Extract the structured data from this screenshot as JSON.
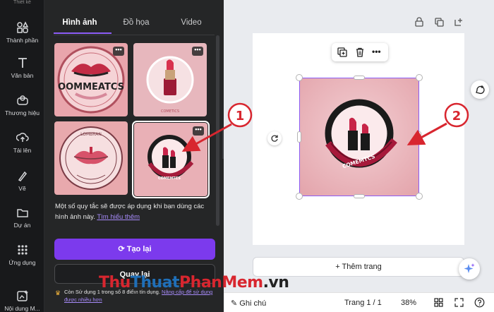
{
  "rail": {
    "top_label": "Thiết kế",
    "items": [
      {
        "label": "Thành phần",
        "icon": "elements-icon"
      },
      {
        "label": "Văn bản",
        "icon": "text-icon"
      },
      {
        "label": "Thương hiệu",
        "icon": "brand-icon"
      },
      {
        "label": "Tải lên",
        "icon": "upload-icon"
      },
      {
        "label": "Vẽ",
        "icon": "draw-icon"
      },
      {
        "label": "Dự án",
        "icon": "folder-icon"
      },
      {
        "label": "Ứng dụng",
        "icon": "apps-icon"
      },
      {
        "label": "Nội dung M...",
        "icon": "magic-media-icon"
      }
    ]
  },
  "panel": {
    "tabs": [
      "Hình ảnh",
      "Đồ họa",
      "Video"
    ],
    "active_tab": 0,
    "thumb_texts": [
      "OOMMEATCS",
      "COMETICS",
      "LOMBRAN",
      "COMEMTCS"
    ],
    "info_text": "Một số quy tắc sẽ được áp dụng khi bạn dùng các hình ảnh này.",
    "info_link": "Tìm hiểu thêm",
    "regen_label": "Tạo lại",
    "back_label": "Quay lại",
    "credit_text": "Còn Sử dụng 1 trong số 8 điểm tín dụng.",
    "credit_link": "Nâng cấp để sử dụng được nhiều hơn"
  },
  "canvas": {
    "logo_text": "COMEMTCS",
    "add_page_label": "+ Thêm trang"
  },
  "bottom_bar": {
    "notes_label": "Ghi chú",
    "page_label": "Trang 1 / 1",
    "zoom_label": "38%"
  },
  "annotations": [
    "1",
    "2"
  ],
  "watermark": {
    "part1": "Thu",
    "part2": "Thuat",
    "part3": "PhanMem",
    "part4": ".vn"
  },
  "colors": {
    "accent": "#7c3aed",
    "annotation": "#d8262f",
    "selection": "#8b5cf6"
  }
}
